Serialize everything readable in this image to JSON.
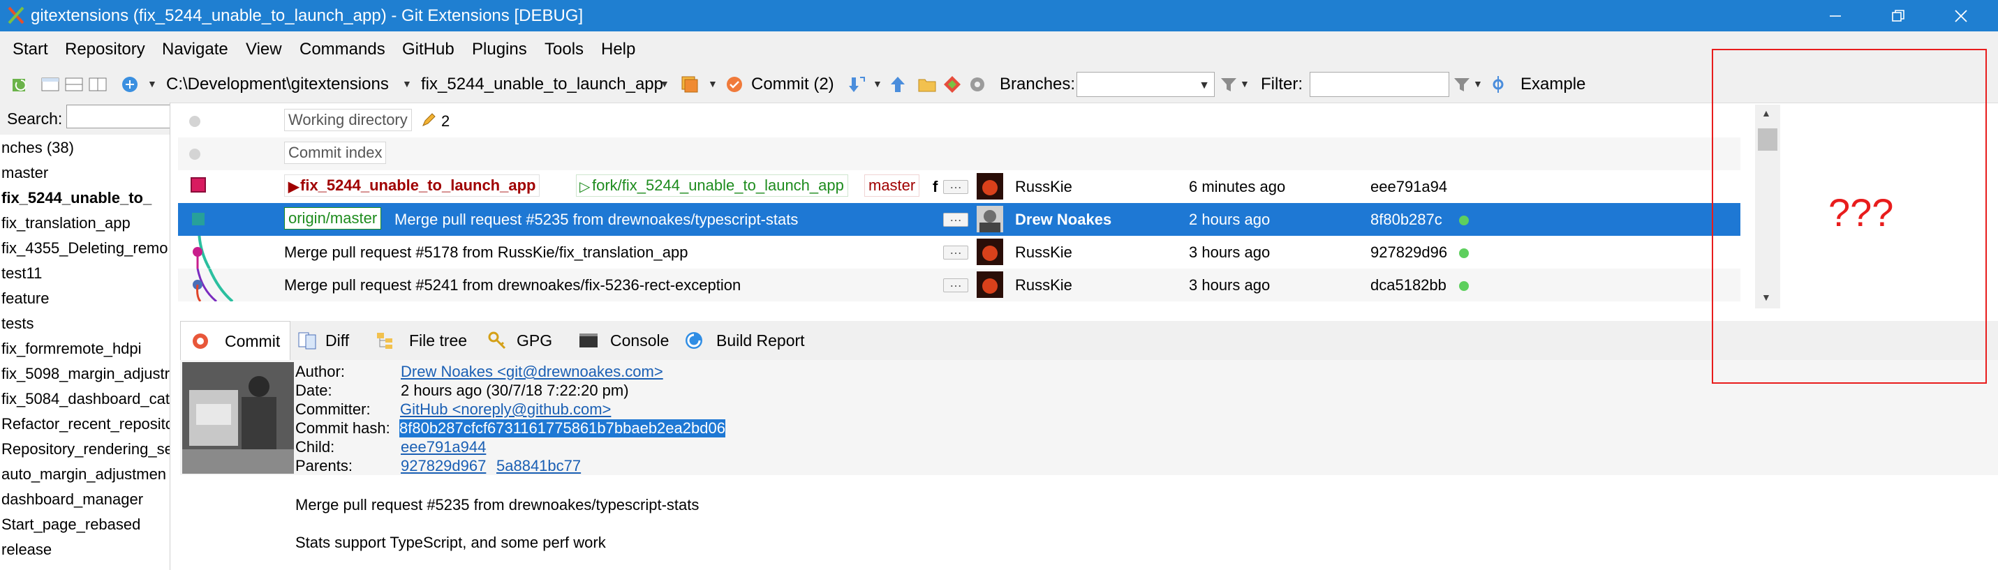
{
  "window": {
    "title": "gitextensions (fix_5244_unable_to_launch_app) - Git Extensions [DEBUG]",
    "controls": [
      "minimize",
      "restore",
      "close"
    ]
  },
  "menu": [
    "Start",
    "Repository",
    "Navigate",
    "View",
    "Commands",
    "GitHub",
    "Plugins",
    "Tools",
    "Help"
  ],
  "toolbar": {
    "repo_path": "C:\\Development\\gitextensions",
    "current_branch": "fix_5244_unable_to_launch_app",
    "commit_label": "Commit (2)",
    "branches_label": "Branches:",
    "branches_value": "",
    "filter_label": "Filter:",
    "filter_value": "",
    "example_label": "Example"
  },
  "left_panel": {
    "search_label": "Search:",
    "search_value": "",
    "branches": [
      "nches (38)",
      "master",
      "fix_5244_unable_to_",
      "fix_translation_app",
      "fix_4355_Deleting_remo",
      "test11",
      "feature",
      "tests",
      "fix_formremote_hdpi",
      "fix_5098_margin_adjustr",
      "fix_5084_dashboard_cat",
      "Refactor_recent_reposito",
      "Repository_rendering_se",
      "auto_margin_adjustmen",
      "dashboard_manager",
      "Start_page_rebased",
      "release"
    ],
    "active_branch_index": 2
  },
  "revision_grid": {
    "working_directory": {
      "label": "Working directory",
      "count": "2"
    },
    "commit_index": {
      "label": "Commit index"
    },
    "rows": [
      {
        "refs": [
          {
            "text": "fix_5244_unable_to_launch_app",
            "kind": "head"
          },
          {
            "text": "fork/fix_5244_unable_to_launch_app",
            "kind": "remote"
          },
          {
            "text": "master",
            "kind": "local"
          }
        ],
        "extra": "f",
        "message": "",
        "author": "RussKie",
        "date": "6 minutes ago",
        "hash": "eee791a94",
        "build_ok": false
      },
      {
        "refs": [
          {
            "text": "origin/master",
            "kind": "remote"
          }
        ],
        "message": "Merge pull request #5235 from drewnoakes/typescript-stats",
        "author": "Drew Noakes",
        "date": "2 hours ago",
        "hash": "8f80b287c",
        "build_ok": true
      },
      {
        "refs": [],
        "message": "Merge pull request #5178 from RussKie/fix_translation_app",
        "author": "RussKie",
        "date": "3 hours ago",
        "hash": "927829d96",
        "build_ok": true
      },
      {
        "refs": [],
        "message": "Merge pull request #5241 from drewnoakes/fix-5236-rect-exception",
        "author": "RussKie",
        "date": "3 hours ago",
        "hash": "dca5182bb",
        "build_ok": true
      }
    ],
    "selected_row_index": 1
  },
  "tabs": [
    {
      "label": "Commit",
      "icon": "commit-icon"
    },
    {
      "label": "Diff",
      "icon": "diff-icon"
    },
    {
      "label": "File tree",
      "icon": "file-tree-icon"
    },
    {
      "label": "GPG",
      "icon": "key-icon"
    },
    {
      "label": "Console",
      "icon": "console-icon"
    },
    {
      "label": "Build Report",
      "icon": "build-report-icon"
    }
  ],
  "active_tab_index": 0,
  "commit_info": {
    "author_label": "Author:",
    "author": "Drew Noakes <git@drewnoakes.com>",
    "date_label": "Date:",
    "date": "2 hours ago (30/7/18 7:22:20 pm)",
    "committer_label": "Committer:",
    "committer": "GitHub <noreply@github.com>",
    "hash_label": "Commit hash:",
    "hash": "8f80b287cfcf6731161775861b7bbaeb2ea2bd06",
    "child_label": "Child:",
    "child": "eee791a944",
    "parents_label": "Parents:",
    "parents": [
      "927829d967",
      "5a8841bc77"
    ],
    "message_title": "Merge pull request #5235 from drewnoakes/typescript-stats",
    "message_body": "Stats support TypeScript, and some perf work"
  },
  "annotation": {
    "text": "???",
    "color": "#e81c1c"
  },
  "colors": {
    "titlebar": "#1f7fd1",
    "selection": "#1e78d4",
    "head_ref": "#a00000",
    "remote_ref": "#1e8c1e",
    "build_ok": "#5ecf5e"
  }
}
